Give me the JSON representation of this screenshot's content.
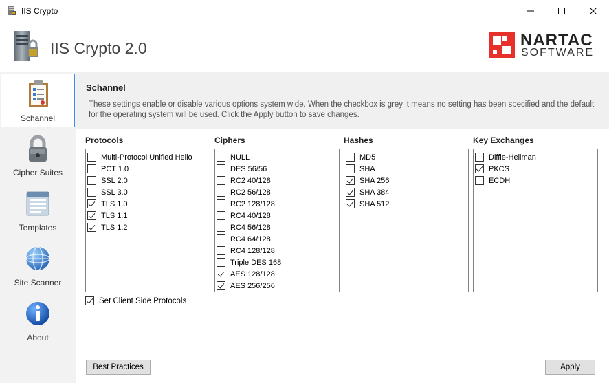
{
  "window": {
    "title": "IIS Crypto",
    "app_name": "IIS Crypto 2.0",
    "logo_line1": "NARTAC",
    "logo_line2": "SOFTWARE",
    "brand_color": "#e8302a"
  },
  "sidebar": {
    "items": [
      {
        "label": "Schannel",
        "icon": "clipboard-icon",
        "active": true
      },
      {
        "label": "Cipher Suites",
        "icon": "padlock-icon",
        "active": false
      },
      {
        "label": "Templates",
        "icon": "template-icon",
        "active": false
      },
      {
        "label": "Site Scanner",
        "icon": "globe-icon",
        "active": false
      },
      {
        "label": "About",
        "icon": "info-icon",
        "active": false
      }
    ]
  },
  "main": {
    "title": "Schannel",
    "description": "These settings enable or disable various options system wide. When the checkbox is grey it means no setting has been specified and the default for the operating system will be used. Click the Apply button to save changes."
  },
  "groups": {
    "protocols": {
      "title": "Protocols",
      "items": [
        {
          "label": "Multi-Protocol Unified Hello",
          "checked": false
        },
        {
          "label": "PCT 1.0",
          "checked": false
        },
        {
          "label": "SSL 2.0",
          "checked": false
        },
        {
          "label": "SSL 3.0",
          "checked": false
        },
        {
          "label": "TLS 1.0",
          "checked": true
        },
        {
          "label": "TLS 1.1",
          "checked": true
        },
        {
          "label": "TLS 1.2",
          "checked": true
        }
      ]
    },
    "ciphers": {
      "title": "Ciphers",
      "items": [
        {
          "label": "NULL",
          "checked": false
        },
        {
          "label": "DES 56/56",
          "checked": false
        },
        {
          "label": "RC2 40/128",
          "checked": false
        },
        {
          "label": "RC2 56/128",
          "checked": false
        },
        {
          "label": "RC2 128/128",
          "checked": false
        },
        {
          "label": "RC4 40/128",
          "checked": false
        },
        {
          "label": "RC4 56/128",
          "checked": false
        },
        {
          "label": "RC4 64/128",
          "checked": false
        },
        {
          "label": "RC4 128/128",
          "checked": false
        },
        {
          "label": "Triple DES 168",
          "checked": false
        },
        {
          "label": "AES 128/128",
          "checked": true
        },
        {
          "label": "AES 256/256",
          "checked": true
        }
      ]
    },
    "hashes": {
      "title": "Hashes",
      "items": [
        {
          "label": "MD5",
          "checked": false
        },
        {
          "label": "SHA",
          "checked": false
        },
        {
          "label": "SHA 256",
          "checked": true
        },
        {
          "label": "SHA 384",
          "checked": true
        },
        {
          "label": "SHA 512",
          "checked": true
        }
      ]
    },
    "key_exchanges": {
      "title": "Key Exchanges",
      "items": [
        {
          "label": "Diffie-Hellman",
          "checked": false
        },
        {
          "label": "PKCS",
          "checked": true
        },
        {
          "label": "ECDH",
          "checked": false
        }
      ]
    }
  },
  "client_side": {
    "label": "Set Client Side Protocols",
    "checked": true
  },
  "buttons": {
    "best_practices": "Best Practices",
    "apply": "Apply"
  }
}
